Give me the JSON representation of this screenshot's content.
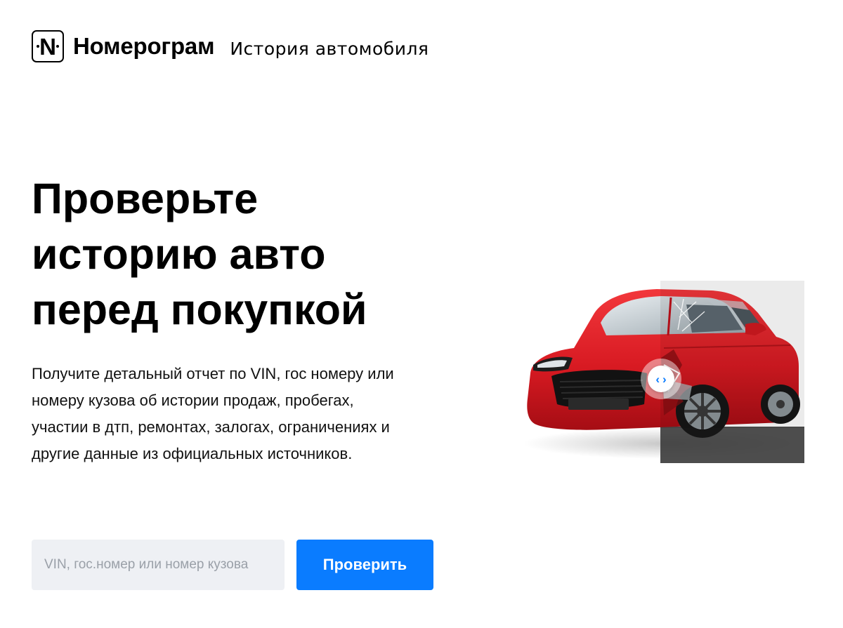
{
  "header": {
    "logo_letter": "N",
    "brand_name": "Номерограм",
    "tagline": "История автомобиля"
  },
  "hero": {
    "title_lines": [
      "Проверьте",
      "историю авто",
      "перед покупкой"
    ],
    "description": "Получите детальный отчет по VIN, гос номеру или номеру кузова об истории продаж, пробегах, участии в дтп, ремонтах, залогах, ограничениях и другие данные из официальных источников."
  },
  "search": {
    "placeholder": "VIN, гос.номер или номер кузова",
    "value": "",
    "button_label": "Проверить"
  },
  "illustration": {
    "compare_handle_left": "‹",
    "compare_handle_right": "›"
  },
  "colors": {
    "accent": "#0a7cff",
    "input_bg": "#eef0f4",
    "car_red": "#e8222a"
  }
}
